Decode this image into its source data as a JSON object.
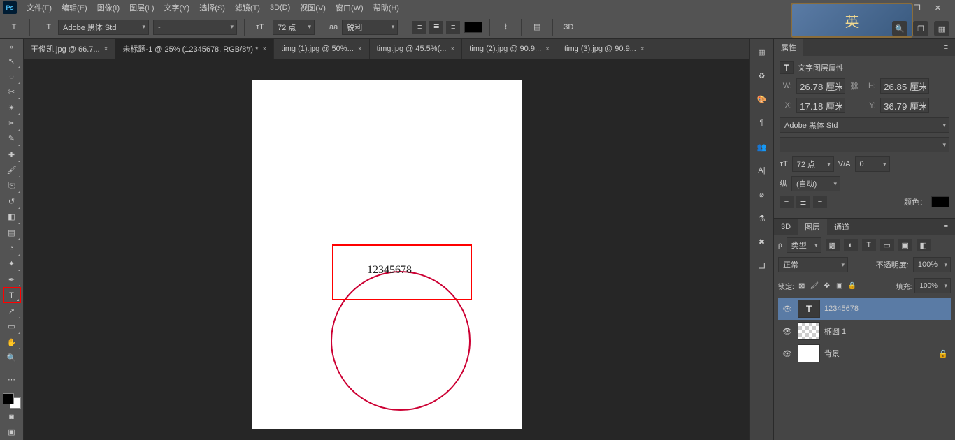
{
  "menu": {
    "items": [
      "文件(F)",
      "编辑(E)",
      "图像(I)",
      "图层(L)",
      "文字(Y)",
      "选择(S)",
      "滤镜(T)",
      "3D(D)",
      "视图(V)",
      "窗口(W)",
      "帮助(H)"
    ]
  },
  "window_buttons": {
    "min": "—",
    "max": "❐",
    "close": "✕"
  },
  "banner": "英",
  "optbar": {
    "font": "Adobe 黑体 Std",
    "style": "-",
    "size": "72 点",
    "aa_label": "aa",
    "aa": "锐利",
    "threed": "3D"
  },
  "topright_icons": [
    "🔍",
    "❐",
    "▦"
  ],
  "tabs": [
    {
      "label": "王俊凯.jpg @ 66.7...",
      "close": "×",
      "active": false
    },
    {
      "label": "未标题-1 @ 25% (12345678, RGB/8#) *",
      "close": "×",
      "active": true
    },
    {
      "label": "timg (1).jpg @ 50%...",
      "close": "×",
      "active": false
    },
    {
      "label": "timg.jpg @ 45.5%(...",
      "close": "×",
      "active": false
    },
    {
      "label": "timg (2).jpg @ 90.9...",
      "close": "×",
      "active": false
    },
    {
      "label": "timg (3).jpg @ 90.9...",
      "close": "×",
      "active": false
    }
  ],
  "canvas": {
    "arc_text": "12345678"
  },
  "tools": [
    "move",
    "rect-marquee",
    "lasso",
    "quick-select",
    "crop",
    "eyedropper",
    "healing",
    "brush",
    "clone",
    "history-brush",
    "eraser",
    "gradient",
    "blur",
    "dodge",
    "pen",
    "type",
    "path-select",
    "rectangle",
    "hand",
    "zoom"
  ],
  "tool_glyphs": [
    "↖",
    "◌",
    "✂",
    "✴",
    "✂",
    "✎",
    "✚",
    "🖌",
    "⎘",
    "↺",
    "◧",
    "▤",
    "◔",
    "✦",
    "✒",
    "T",
    "↗",
    "▭",
    "✋",
    "🔍"
  ],
  "vert_panel": [
    "▦",
    "♻",
    "🎨",
    "¶",
    "👥",
    "A|",
    "⌀",
    "⚗",
    "✖",
    "❑"
  ],
  "properties": {
    "tab": "属性",
    "title": "文字图层属性",
    "w_label": "W:",
    "w": "26.78 厘米",
    "h_label": "H:",
    "h": "26.85 厘米",
    "x_label": "X:",
    "x": "17.18 厘米",
    "y_label": "Y:",
    "y": "36.79 厘米",
    "font": "Adobe 黑体 Std",
    "size": "72 点",
    "va": "0",
    "leading_label": "纵",
    "leading": "(自动)",
    "color_label": "颜色："
  },
  "layers_panel": {
    "tabs": [
      "3D",
      "图层",
      "通道"
    ],
    "active_tab": 1,
    "kind_label": "类型",
    "blend": "正常",
    "opacity_label": "不透明度:",
    "opacity": "100%",
    "lock_label": "锁定:",
    "fill_label": "填充:",
    "fill": "100%",
    "layers": [
      {
        "name": "12345678",
        "type": "T",
        "selected": true
      },
      {
        "name": "椭圆 1",
        "type": "checker",
        "selected": false
      },
      {
        "name": "背景",
        "type": "white",
        "selected": false,
        "locked": true
      }
    ]
  }
}
